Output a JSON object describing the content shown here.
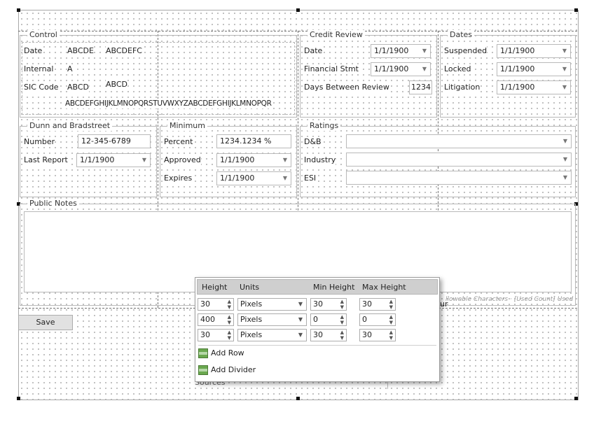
{
  "control": {
    "title": "Control",
    "date_label": "Date",
    "date_value1": "ABCDE",
    "date_value2": "ABCDEFC",
    "internal_label": "Internal",
    "internal_value": "A",
    "sic_label": "SIC Code",
    "sic_value1": "ABCD",
    "sic_value2": "ABCD",
    "alphabet": "ABCDEFGHIJKLMNOPQRSTUVWXYZABCDEFGHIJKLMNOPQR"
  },
  "credit_review": {
    "title": "Credit Review",
    "date_label": "Date",
    "date_value": "1/1/1900",
    "financial_label": "Financial Stmt",
    "financial_value": "1/1/1900",
    "days_label": "Days Between Review",
    "days_value": "1234"
  },
  "dates": {
    "title": "Dates",
    "suspended_label": "Suspended",
    "suspended_value": "1/1/1900",
    "locked_label": "Locked",
    "locked_value": "1/1/1900",
    "litigation_label": "Litigation",
    "litigation_value": "1/1/1900"
  },
  "dunn": {
    "title": "Dunn and Bradstreet",
    "number_label": "Number",
    "number_value": "12-345-6789",
    "last_label": "Last Report",
    "last_value": "1/1/1900"
  },
  "minimum": {
    "title": "Minimum",
    "percent_label": "Percent",
    "percent_value": "1234.1234 %",
    "approved_label": "Approved",
    "approved_value": "1/1/1900",
    "expires_label": "Expires",
    "expires_value": "1/1/1900"
  },
  "ratings": {
    "title": "Ratings",
    "db_label": "D&B",
    "industry_label": "Industry",
    "esi_label": "ESI"
  },
  "public_notes": {
    "title": "Public Notes",
    "hint": "llowable Characters · [Used Count] Used",
    "hint_clip": "ur"
  },
  "save_label": "Save",
  "bottom_label": "Sources",
  "row_editor": {
    "headers": {
      "height": "Height",
      "units": "Units",
      "min": "Min Height",
      "max": "Max Height"
    },
    "rows": [
      {
        "height": "30",
        "units": "Pixels",
        "min": "30",
        "max": "30"
      },
      {
        "height": "400",
        "units": "Pixels",
        "min": "0",
        "max": "0"
      },
      {
        "height": "30",
        "units": "Pixels",
        "min": "30",
        "max": "30"
      }
    ],
    "add_row": "Add Row",
    "add_divider": "Add Divider"
  },
  "icons": {
    "combo": "chevron-down-icon",
    "spinner": "spinner-arrows-icon",
    "row": "add-row-icon"
  }
}
